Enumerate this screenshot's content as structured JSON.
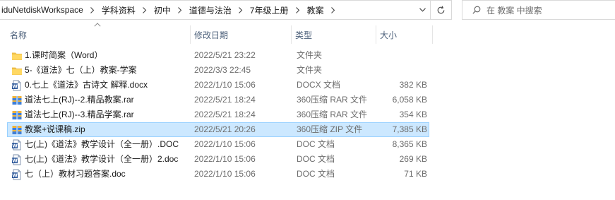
{
  "breadcrumb": {
    "items": [
      {
        "label": "iduNetdiskWorkspace"
      },
      {
        "label": "学科资料"
      },
      {
        "label": "初中"
      },
      {
        "label": "道德与法治"
      },
      {
        "label": "7年级上册"
      },
      {
        "label": "教案"
      }
    ]
  },
  "search": {
    "placeholder": "在 教案 中搜索"
  },
  "columns": {
    "name": "名称",
    "modified": "修改日期",
    "type": "类型",
    "size": "大小"
  },
  "files": [
    {
      "icon": "folder-icon",
      "name": "1.课时简案（Word）",
      "modified": "2022/5/21 23:22",
      "type": "文件夹",
      "size": ""
    },
    {
      "icon": "folder-icon",
      "name": "5-《道法》七（上）教案-学案",
      "modified": "2022/3/3 22:45",
      "type": "文件夹",
      "size": ""
    },
    {
      "icon": "word-doc-icon",
      "name": "0.七上《道法》古诗文 解释.docx",
      "modified": "2022/1/10 15:06",
      "type": "DOCX 文档",
      "size": "382 KB"
    },
    {
      "icon": "rar-archive-icon",
      "name": "道法七上(RJ)--2.精品教案.rar",
      "modified": "2022/5/21 18:24",
      "type": "360压缩 RAR 文件",
      "size": "6,058 KB"
    },
    {
      "icon": "rar-archive-icon",
      "name": "道法七上(RJ)--3.精品学案.rar",
      "modified": "2022/5/21 18:24",
      "type": "360压缩 RAR 文件",
      "size": "354 KB"
    },
    {
      "icon": "zip-archive-icon",
      "name": "教案+说课稿.zip",
      "modified": "2022/5/21 20:26",
      "type": "360压缩 ZIP 文件",
      "size": "7,385 KB",
      "selected": true
    },
    {
      "icon": "word-doc-icon",
      "name": "七(上)《道法》教学设计（全一册）.DOC",
      "modified": "2022/1/10 15:06",
      "type": "DOC 文档",
      "size": "8,365 KB"
    },
    {
      "icon": "word-doc-icon",
      "name": "七(上)《道法》教学设计（全一册）2.doc",
      "modified": "2022/1/10 15:06",
      "type": "DOC 文档",
      "size": "269 KB"
    },
    {
      "icon": "word-doc-icon",
      "name": "七（上）教材习题答案.doc",
      "modified": "2022/1/10 15:06",
      "type": "DOC 文档",
      "size": "71 KB"
    }
  ],
  "colors": {
    "selection_bg": "#cce8ff",
    "selection_border": "#99d1ff",
    "header_text": "#4c607a",
    "folder": "#f0c24f",
    "word_blue": "#2b579a"
  }
}
